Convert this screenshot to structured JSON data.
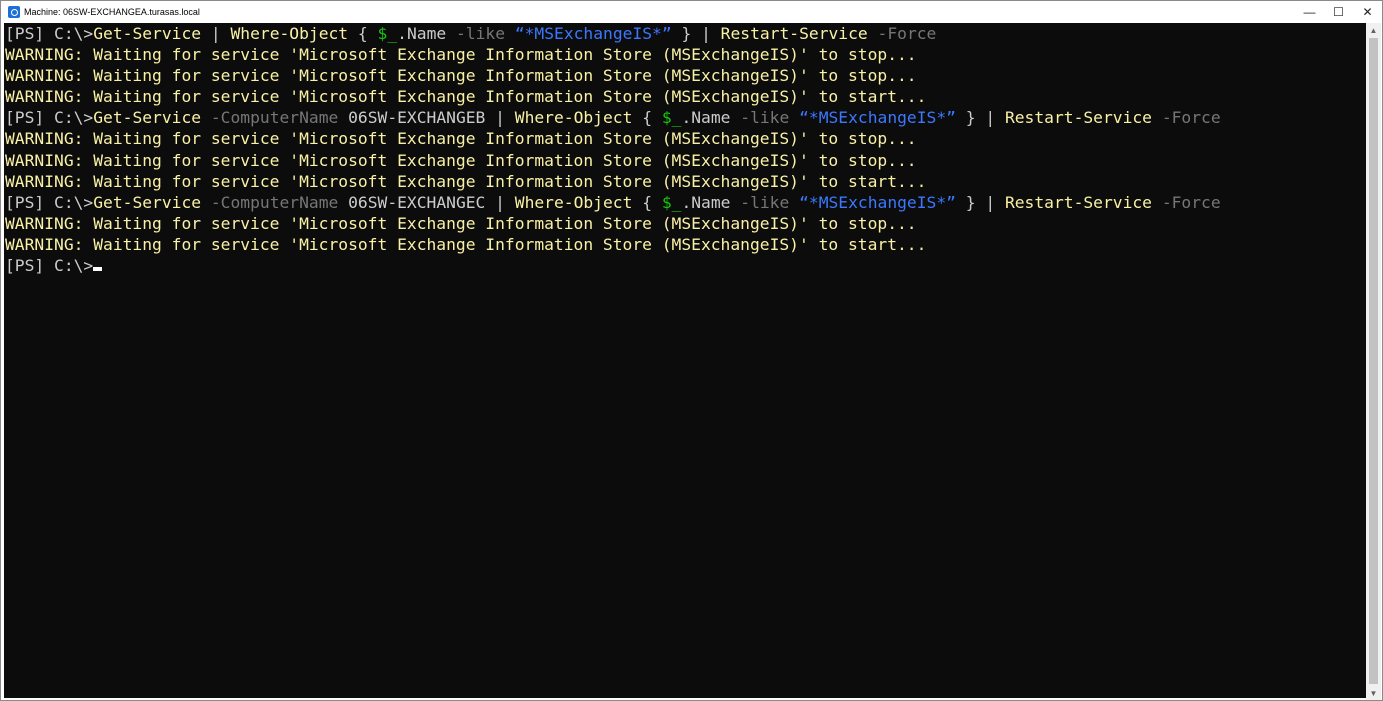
{
  "window": {
    "title": "Machine: 06SW-EXCHANGEA.turasas.local",
    "controls": {
      "minimize": "—",
      "maximize": "☐",
      "close": "✕"
    }
  },
  "console": {
    "prompt": "[PS] C:\\>",
    "cmd1": {
      "get": "Get-Service",
      "pipe1": " | ",
      "where": "Where-Object",
      "brace_open": " { ",
      "var": "$_",
      "name": ".Name ",
      "like": "-like",
      "space": " ",
      "pattern": "“*MSExchangeIS*”",
      "brace_close": " } | ",
      "restart": "Restart-Service",
      "space2": " ",
      "force": "-Force"
    },
    "cmd2": {
      "get": "Get-Service",
      "space": " ",
      "computer_param": "-ComputerName",
      "computer": " 06SW-EXCHANGEB | ",
      "where": "Where-Object",
      "brace_open": " { ",
      "var": "$_",
      "name": ".Name ",
      "like": "-like",
      "space2": " ",
      "pattern": "“*MSExchangeIS*”",
      "brace_close": " } | ",
      "restart": "Restart-Service",
      "space3": " ",
      "force": "-Force"
    },
    "cmd3": {
      "get": "Get-Service",
      "space": " ",
      "computer_param": "-ComputerName",
      "computer": " 06SW-EXCHANGEC | ",
      "where": "Where-Object",
      "brace_open": " { ",
      "var": "$_",
      "name": ".Name ",
      "like": "-like",
      "space2": " ",
      "pattern": "“*MSExchangeIS*”",
      "brace_close": " } | ",
      "restart": "Restart-Service",
      "space3": " ",
      "force": "-Force"
    },
    "warn_stop": "WARNING: Waiting for service 'Microsoft Exchange Information Store (MSExchangeIS)' to stop...",
    "warn_start": "WARNING: Waiting for service 'Microsoft Exchange Information Store (MSExchangeIS)' to start..."
  },
  "scrollbar": {
    "up": "▲",
    "down": "▼"
  }
}
